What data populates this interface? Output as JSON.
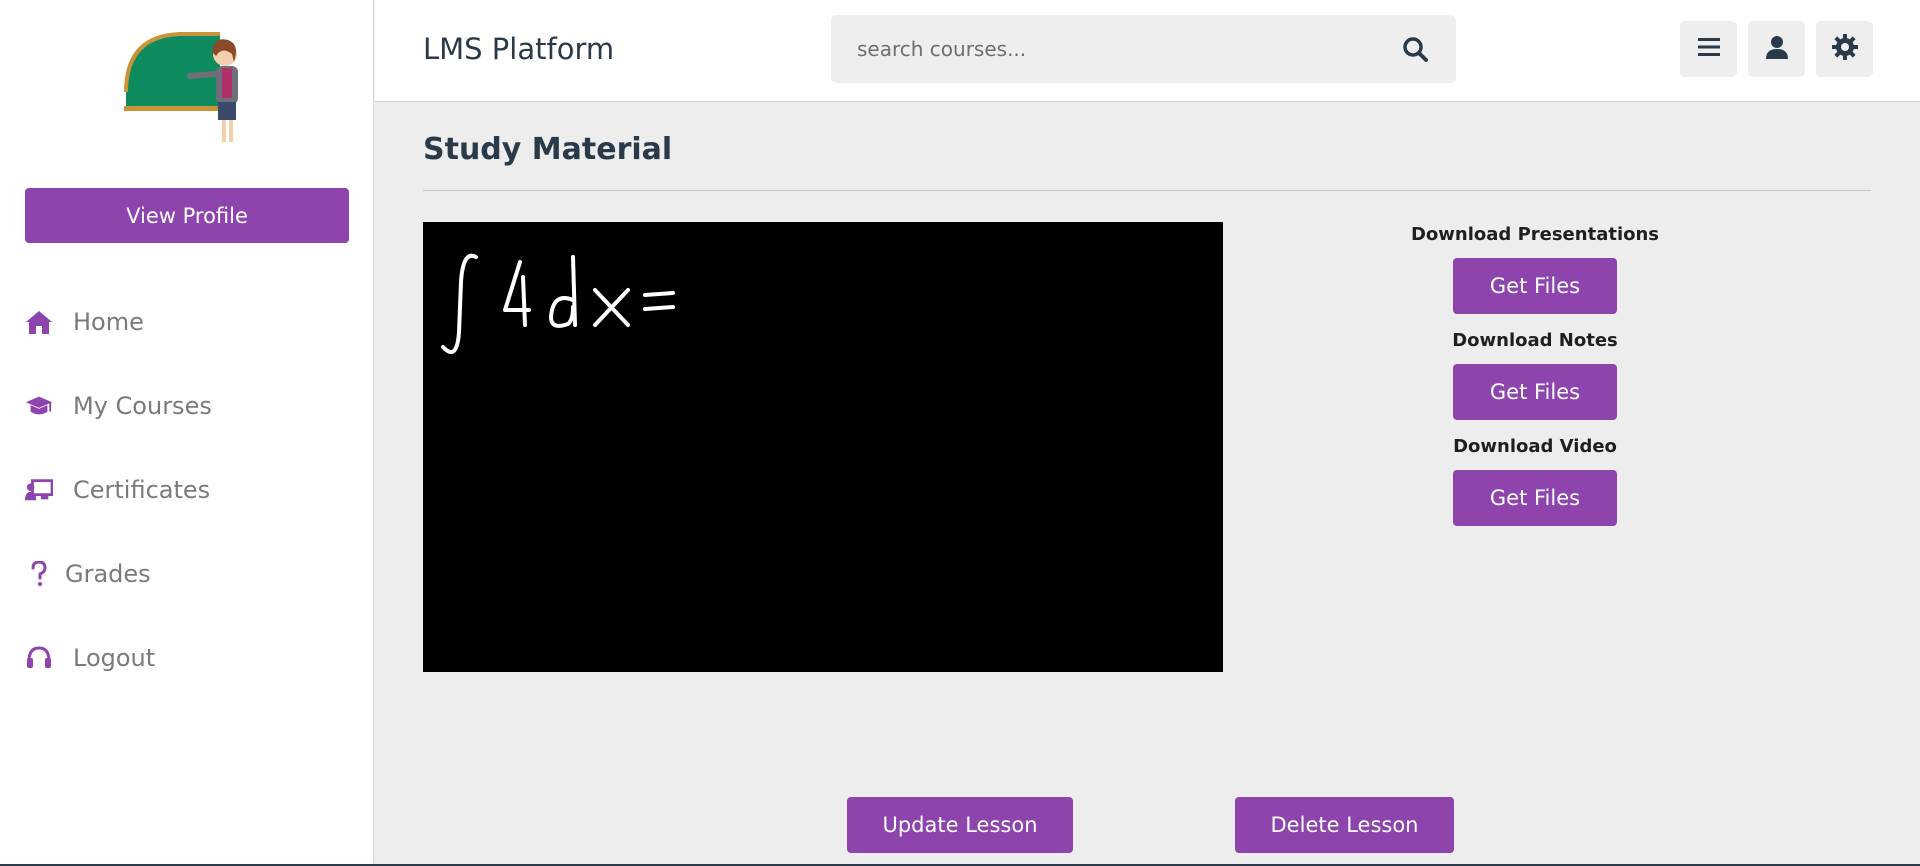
{
  "app": {
    "brand": "LMS Platform"
  },
  "colors": {
    "accent": "#8e44ad",
    "text": "#2b3a4a",
    "background": "#ededed"
  },
  "search": {
    "placeholder": "search courses..."
  },
  "header_icons": [
    "menu-icon",
    "user-icon",
    "settings-icon"
  ],
  "sidebar": {
    "view_profile_label": "View Profile",
    "items": [
      {
        "label": "Home",
        "icon": "home-icon"
      },
      {
        "label": "My Courses",
        "icon": "graduation-cap-icon"
      },
      {
        "label": "Certificates",
        "icon": "certificate-icon"
      },
      {
        "label": "Grades",
        "icon": "question-icon"
      },
      {
        "label": "Logout",
        "icon": "headset-icon"
      }
    ]
  },
  "main": {
    "title": "Study Material",
    "downloads": [
      {
        "label": "Download Presentations",
        "button": "Get Files"
      },
      {
        "label": "Download Notes",
        "button": "Get Files"
      },
      {
        "label": "Download Video",
        "button": "Get Files"
      }
    ],
    "update_label": "Update Lesson",
    "delete_label": "Delete Lesson"
  }
}
